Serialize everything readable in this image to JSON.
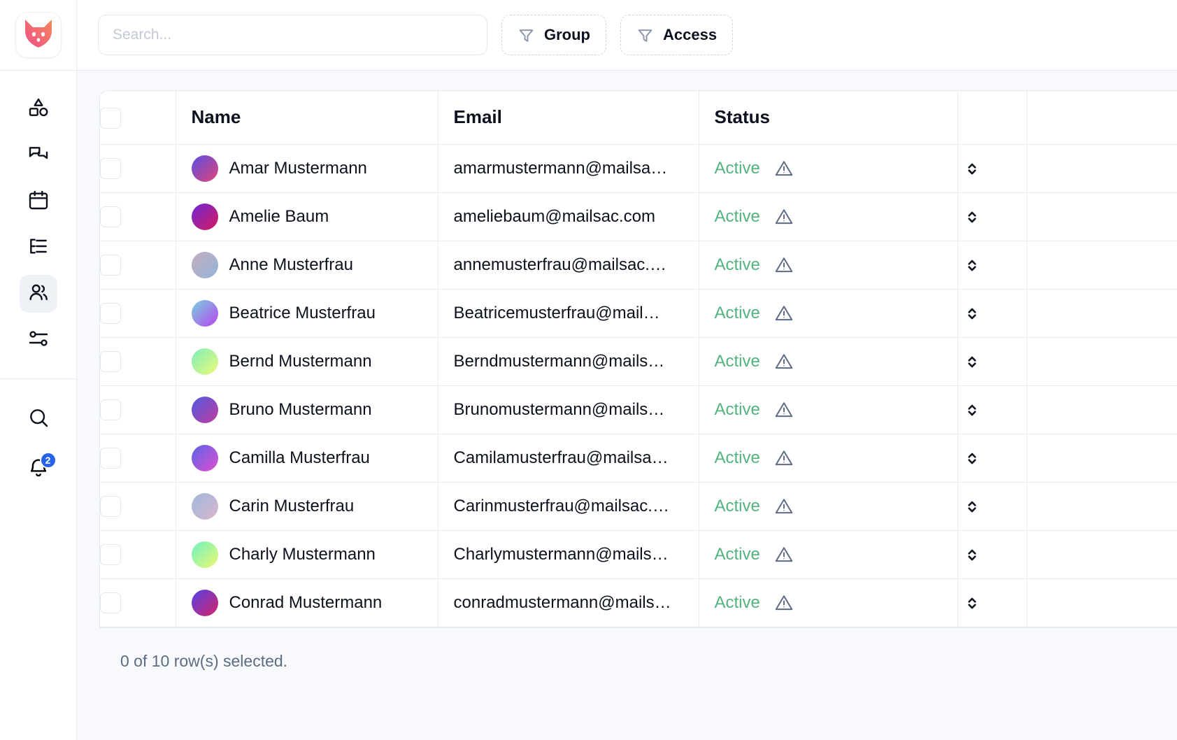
{
  "sidebar": {
    "logo": {
      "icon": "fox-logo-icon",
      "colors": {
        "from": "#f2557d",
        "to": "#f5865f"
      }
    },
    "nav_primary": [
      {
        "id": "shapes",
        "icon": "shapes-icon",
        "active": false
      },
      {
        "id": "messages",
        "icon": "chat-bubbles-icon",
        "active": false
      },
      {
        "id": "calendar",
        "icon": "calendar-icon",
        "active": false
      },
      {
        "id": "list",
        "icon": "list-tree-icon",
        "active": false
      },
      {
        "id": "users",
        "icon": "users-icon",
        "active": true
      },
      {
        "id": "settings",
        "icon": "sliders-icon",
        "active": false
      }
    ],
    "nav_secondary": [
      {
        "id": "search",
        "icon": "search-icon",
        "badge": null
      },
      {
        "id": "notifications",
        "icon": "bell-icon",
        "badge": "2"
      }
    ],
    "badge_color": "#2563eb"
  },
  "topbar": {
    "search": {
      "placeholder": "Search...",
      "value": ""
    },
    "filters": [
      {
        "id": "group",
        "label": "Group",
        "icon": "funnel-icon"
      },
      {
        "id": "access",
        "label": "Access",
        "icon": "funnel-icon"
      }
    ]
  },
  "table": {
    "columns": [
      "",
      "Name",
      "Email",
      "Status",
      "",
      ""
    ],
    "headers": {
      "name": "Name",
      "email": "Email",
      "status": "Status"
    },
    "status_color": "#53b37f",
    "rows": [
      {
        "name": "Amar Mustermann",
        "email": "amarmustermann@mailsa…",
        "status": "Active",
        "avatar_from": "#5b4fe0",
        "avatar_to": "#e0457b"
      },
      {
        "name": "Amelie Baum",
        "email": "ameliebaum@mailsac.com",
        "status": "Active",
        "avatar_from": "#6d28d9",
        "avatar_to": "#d61a5b"
      },
      {
        "name": "Anne Musterfrau",
        "email": "annemusterfrau@mailsac.…",
        "status": "Active",
        "avatar_from": "#c6aebe",
        "avatar_to": "#92b4d8"
      },
      {
        "name": "Beatrice Musterfrau",
        "email": "Beatricemusterfrau@mail…",
        "status": "Active",
        "avatar_from": "#7ad2e0",
        "avatar_to": "#b844f0"
      },
      {
        "name": "Bernd Mustermann",
        "email": "Berndmustermann@mails…",
        "status": "Active",
        "avatar_from": "#7df0b8",
        "avatar_to": "#eef97a"
      },
      {
        "name": "Bruno Mustermann",
        "email": "Brunomustermann@mails…",
        "status": "Active",
        "avatar_from": "#4f5ae0",
        "avatar_to": "#c23ba0"
      },
      {
        "name": "Camilla Musterfrau",
        "email": "Camilamusterfrau@mailsa…",
        "status": "Active",
        "avatar_from": "#5b63e8",
        "avatar_to": "#e04fd0"
      },
      {
        "name": "Carin Musterfrau",
        "email": "Carinmusterfrau@mailsac.…",
        "status": "Active",
        "avatar_from": "#9fb8dd",
        "avatar_to": "#d9b6cb"
      },
      {
        "name": "Charly Mustermann",
        "email": "Charlymustermann@mails…",
        "status": "Active",
        "avatar_from": "#6ef2c4",
        "avatar_to": "#ecf96e"
      },
      {
        "name": "Conrad Mustermann",
        "email": "conradmustermann@mails…",
        "status": "Active",
        "avatar_from": "#5243e6",
        "avatar_to": "#d6246a"
      }
    ]
  },
  "footer": {
    "selection_text": "0 of 10 row(s) selected."
  }
}
